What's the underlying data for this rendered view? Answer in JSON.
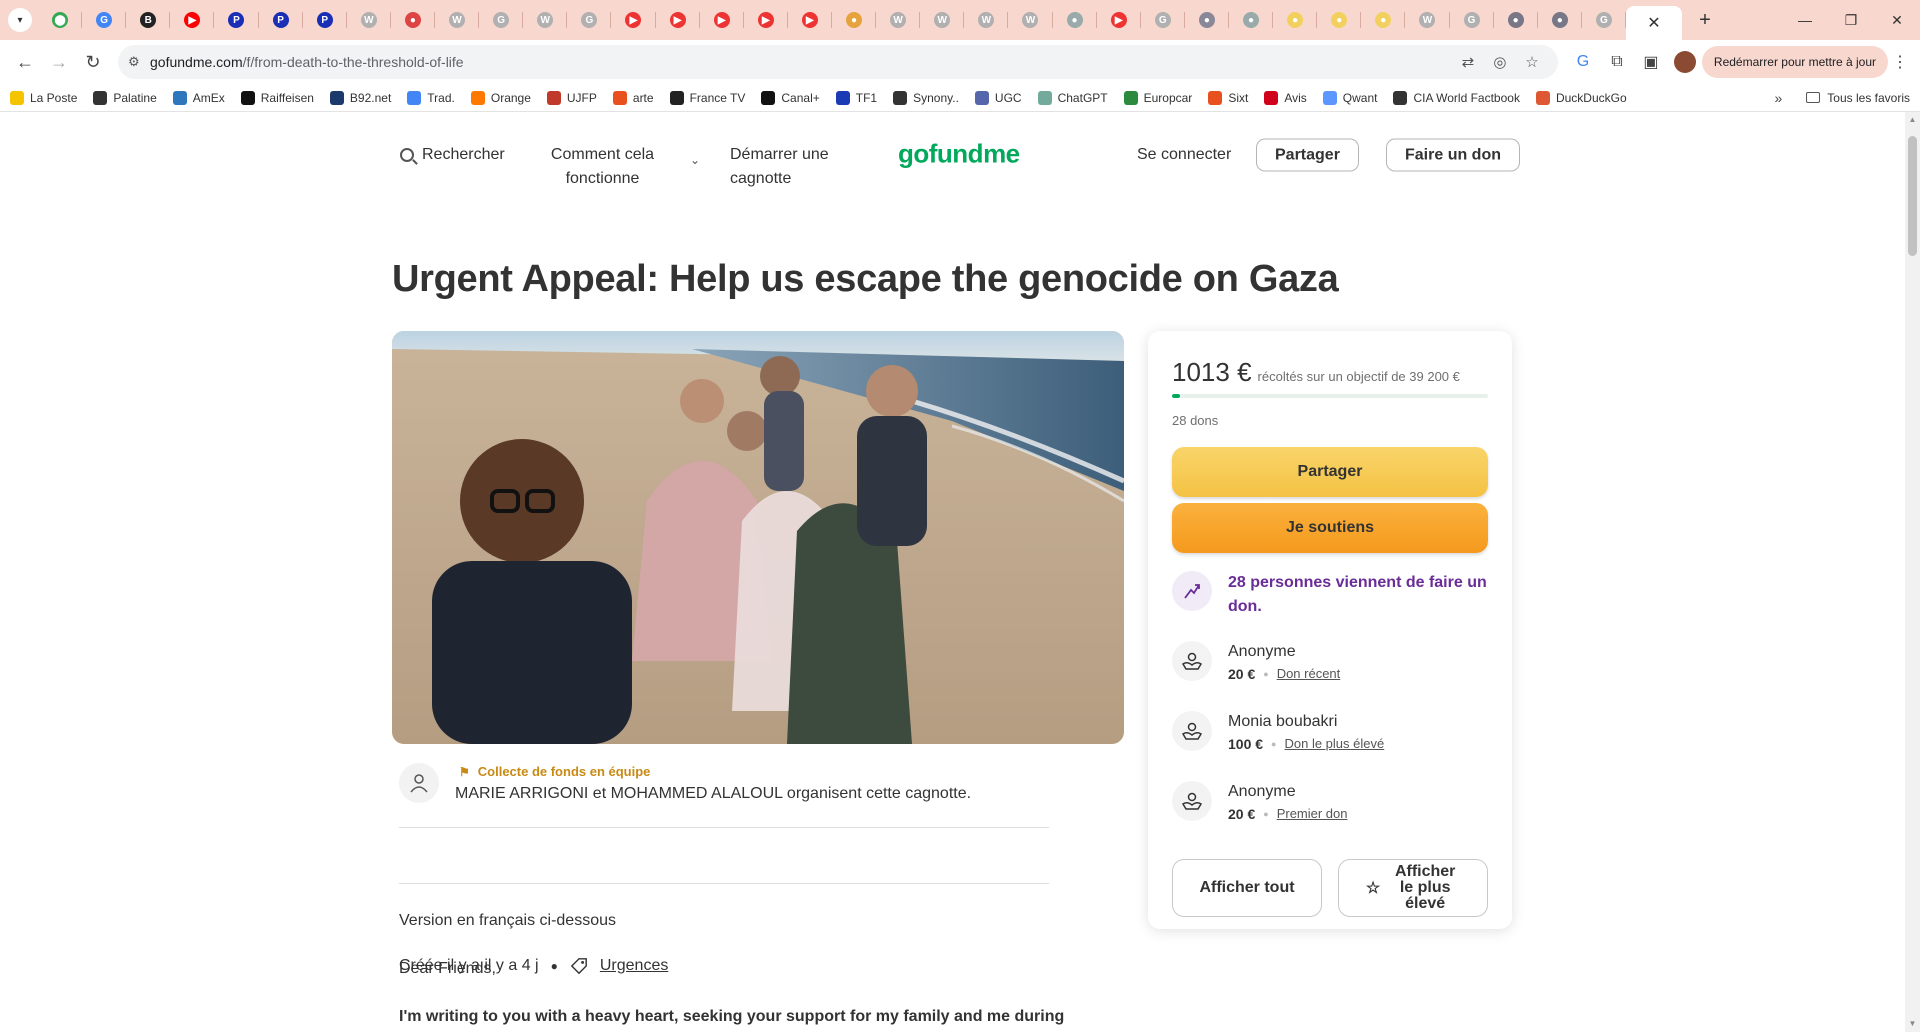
{
  "browser": {
    "pinned_tabs": [
      {
        "icon": "maps-icon",
        "color": "#34a853",
        "glyph": "⬤"
      },
      {
        "icon": "translate-icon",
        "color": "#4285f4",
        "glyph": "G"
      },
      {
        "icon": "bbc-icon",
        "color": "#222222",
        "glyph": "B"
      },
      {
        "icon": "youtube-icon",
        "color": "#ff0000",
        "glyph": "▶"
      },
      {
        "icon": "p-icon",
        "color": "#1a2fb5",
        "glyph": "P"
      },
      {
        "icon": "p-icon",
        "color": "#1a2fb5",
        "glyph": "P"
      },
      {
        "icon": "p-icon",
        "color": "#1a2fb5",
        "glyph": "P"
      },
      {
        "icon": "wikipedia-icon",
        "color": "#b0b0b0",
        "glyph": "W"
      },
      {
        "icon": "generic-icon",
        "color": "#d44",
        "glyph": "●"
      },
      {
        "icon": "wikipedia-icon",
        "color": "#b0b0b0",
        "glyph": "W"
      },
      {
        "icon": "google-icon",
        "color": "#b0b0b0",
        "glyph": "G"
      },
      {
        "icon": "wikipedia-icon",
        "color": "#b0b0b0",
        "glyph": "W"
      },
      {
        "icon": "google-icon",
        "color": "#b0b0b0",
        "glyph": "G"
      },
      {
        "icon": "youtube-icon",
        "color": "#e33",
        "glyph": "▶"
      },
      {
        "icon": "youtube-icon",
        "color": "#e33",
        "glyph": "▶"
      },
      {
        "icon": "youtube-icon",
        "color": "#e33",
        "glyph": "▶"
      },
      {
        "icon": "youtube-icon",
        "color": "#e33",
        "glyph": "▶"
      },
      {
        "icon": "youtube-icon",
        "color": "#e33",
        "glyph": "▶"
      },
      {
        "icon": "generic-icon",
        "color": "#e6a23c",
        "glyph": "●"
      },
      {
        "icon": "wikipedia-icon",
        "color": "#b0b0b0",
        "glyph": "W"
      },
      {
        "icon": "wikipedia-icon",
        "color": "#b0b0b0",
        "glyph": "W"
      },
      {
        "icon": "wikipedia-icon",
        "color": "#b0b0b0",
        "glyph": "W"
      },
      {
        "icon": "wikipedia-icon",
        "color": "#b0b0b0",
        "glyph": "W"
      },
      {
        "icon": "generic-icon",
        "color": "#9aa",
        "glyph": "●"
      },
      {
        "icon": "youtube-icon",
        "color": "#e33",
        "glyph": "▶"
      },
      {
        "icon": "google-icon",
        "color": "#b0b0b0",
        "glyph": "G"
      },
      {
        "icon": "generic-icon",
        "color": "#889",
        "glyph": "●"
      },
      {
        "icon": "generic-icon",
        "color": "#9aa",
        "glyph": "●"
      },
      {
        "icon": "generic-icon",
        "color": "#f2d060",
        "glyph": "●"
      },
      {
        "icon": "generic-icon",
        "color": "#f2d060",
        "glyph": "●"
      },
      {
        "icon": "generic-icon",
        "color": "#f2d060",
        "glyph": "●"
      },
      {
        "icon": "wikipedia-icon",
        "color": "#b0b0b0",
        "glyph": "W"
      },
      {
        "icon": "google-icon",
        "color": "#b0b0b0",
        "glyph": "G"
      },
      {
        "icon": "generic-icon",
        "color": "#778",
        "glyph": "●"
      },
      {
        "icon": "generic-icon",
        "color": "#778",
        "glyph": "●"
      },
      {
        "icon": "google-icon",
        "color": "#b0b0b0",
        "glyph": "G"
      }
    ],
    "active_tab_close": "✕",
    "new_tab": "+",
    "url_host": "gofundme.com",
    "url_path": "/f/from-death-to-the-threshold-of-life",
    "update_button": "Redémarrer pour mettre à jour",
    "bookmarks": [
      {
        "label": "La Poste",
        "color": "#f5c400"
      },
      {
        "label": "Palatine",
        "color": "#333333"
      },
      {
        "label": "AmEx",
        "color": "#2e77bc"
      },
      {
        "label": "Raiffeisen",
        "color": "#111111"
      },
      {
        "label": "B92.net",
        "color": "#1b3a6b"
      },
      {
        "label": "Trad.",
        "color": "#4285f4"
      },
      {
        "label": "Orange",
        "color": "#ff7900"
      },
      {
        "label": "UJFP",
        "color": "#c0392b"
      },
      {
        "label": "arte",
        "color": "#e8501e"
      },
      {
        "label": "France TV",
        "color": "#222222"
      },
      {
        "label": "Canal+",
        "color": "#111111"
      },
      {
        "label": "TF1",
        "color": "#1a3bb3"
      },
      {
        "label": "Synony..",
        "color": "#333333"
      },
      {
        "label": "UGC",
        "color": "#5566aa"
      },
      {
        "label": "ChatGPT",
        "color": "#74aa9c"
      },
      {
        "label": "Europcar",
        "color": "#2b8a3e"
      },
      {
        "label": "Sixt",
        "color": "#e8501e"
      },
      {
        "label": "Avis",
        "color": "#d0021b"
      },
      {
        "label": "Qwant",
        "color": "#5c97ff"
      },
      {
        "label": "CIA World Factbook",
        "color": "#333333"
      },
      {
        "label": "DuckDuckGo",
        "color": "#de5833"
      }
    ],
    "bookmarks_more": "»",
    "all_bookmarks": "Tous les favoris"
  },
  "header": {
    "search": "Rechercher",
    "how_it_works": "Comment cela fonctionne",
    "start": "Démarrer une cagnotte",
    "logo": "gofundme",
    "sign_in": "Se connecter",
    "share": "Partager",
    "donate": "Faire un don"
  },
  "campaign": {
    "title": "Urgent Appeal: Help us escape the genocide on Gaza",
    "team_tag": "Collecte de fonds en équipe",
    "organizers": "MARIE ARRIGONI et MOHAMMED ALALOUL organisent cette cagnotte.",
    "created": "Créée il y a il y a 4 j",
    "category": "Urgences",
    "paragraphs": [
      "Version en français ci-dessous",
      "Dear Friends,",
      "I'm writing to you with a heavy heart, seeking your support for my family and me during"
    ]
  },
  "card": {
    "raised": "1013 €",
    "goal_text": "récoltés sur un objectif de 39 200 €",
    "progress_fraction": 0.026,
    "donations_count": "28 dons",
    "share_btn": "Partager",
    "support_btn": "Je soutiens",
    "recent_notice": "28 personnes viennent de faire un don.",
    "donations": [
      {
        "name": "Anonyme",
        "amount": "20 €",
        "label": "Don récent"
      },
      {
        "name": "Monia boubakri",
        "amount": "100 €",
        "label": "Don le plus élevé"
      },
      {
        "name": "Anonyme",
        "amount": "20 €",
        "label": "Premier don"
      }
    ],
    "see_all": "Afficher tout",
    "see_top": "Afficher le plus élevé"
  },
  "colors": {
    "brand_green": "#02a95c",
    "share_yellow": "#f4c243",
    "support_orange": "#f49a1d",
    "recent_purple": "#6a2d97",
    "team_tag_gold": "#c88a15"
  }
}
